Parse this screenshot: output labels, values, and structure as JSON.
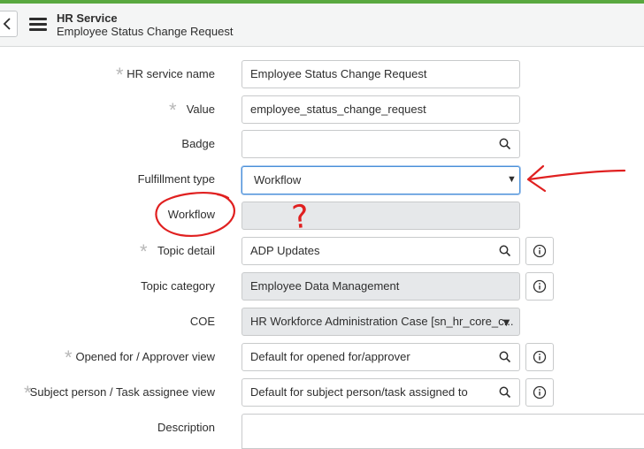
{
  "header": {
    "title": "HR Service",
    "subtitle": "Employee Status Change Request"
  },
  "form": {
    "hr_service_name": {
      "label": "HR service name",
      "value": "Employee Status Change Request"
    },
    "value": {
      "label": "Value",
      "value": "employee_status_change_request"
    },
    "badge": {
      "label": "Badge",
      "value": ""
    },
    "fulfillment_type": {
      "label": "Fulfillment type",
      "value": "Workflow"
    },
    "workflow": {
      "label": "Workflow",
      "value": ""
    },
    "topic_detail": {
      "label": "Topic detail",
      "value": "ADP Updates"
    },
    "topic_category": {
      "label": "Topic category",
      "value": "Employee Data Management"
    },
    "coe": {
      "label": "COE",
      "value": "HR Workforce Administration Case [sn_hr_core_c..."
    },
    "opened_for_view": {
      "label": "Opened for / Approver view",
      "value": "Default for opened for/approver"
    },
    "subject_person_view": {
      "label": "Subject person / Task assignee view",
      "value": "Default for subject person/task assigned to"
    },
    "description": {
      "label": "Description",
      "value": ""
    }
  },
  "annotations": {
    "question_mark": "?",
    "ink_color": "#e02020"
  }
}
